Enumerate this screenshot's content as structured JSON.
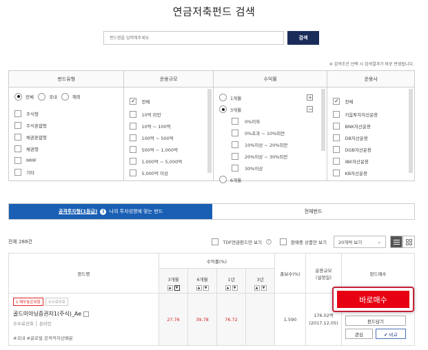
{
  "page": {
    "title": "연금저축펀드 검색"
  },
  "search": {
    "placeholder": "펀드명을 입력해주세요",
    "button": "검색"
  },
  "filter_note": "※ 검색조건 선택 시 검색결과가 바로 반영됩니다.",
  "filters": {
    "fund_type": {
      "title": "펀드유형",
      "radios": [
        "전체",
        "국내",
        "해외"
      ],
      "options": [
        "주식형",
        "주식혼합형",
        "채권혼합형",
        "채권형",
        "MMF",
        "기타"
      ]
    },
    "fund_size": {
      "title": "운용규모",
      "options": [
        "전체",
        "10억 미만",
        "10억 ~ 100억",
        "100억 ~ 500억",
        "500억 ~ 1,000억",
        "1,000억 ~ 5,000억",
        "5,000억 이상"
      ]
    },
    "returns": {
      "title": "수익률",
      "period_1m": "1개월",
      "period_3m": "3개월",
      "sub_options": [
        "0%이하",
        "0%초과 ~ 10%미만",
        "10%이상 ~ 20%미만",
        "20%이상 ~ 30%미만",
        "30%이상"
      ],
      "period_6m": "6개월",
      "plus": "+",
      "minus": "−"
    },
    "manager": {
      "title": "운용사",
      "options": [
        "전체",
        "키움투자자산운용",
        "BNK자산운용",
        "DB자산운용",
        "DGB자산운용",
        "IBK자산운용",
        "KB자산운용"
      ]
    }
  },
  "tabs": {
    "active_strong": "공격투자형(1등급)",
    "active_rest": "나의 투자성향에 맞는 펀드",
    "info_icon": "i",
    "inactive": "전체펀드"
  },
  "toolbar": {
    "total": "전체 288건",
    "tdf_label": "TDF연금펀드만 보기",
    "help": "?",
    "on_sale_label": "판매중 상품만 보기",
    "per_page": "20개씩 보기",
    "caret": "⌄"
  },
  "table": {
    "headers": {
      "fund_name": "펀드명",
      "returns": "수익률(%)",
      "periods": [
        "3개월",
        "6개월",
        "1년",
        "3년"
      ],
      "fee": "총보수(%)",
      "size_line1": "운용규모",
      "size_line2": "(설정일)",
      "buy": "펀드매수"
    },
    "sort": {
      "up": "▲",
      "down": "▼"
    },
    "rows": [
      {
        "badge_risk": "1 매우높은위험",
        "badge_fee": "수수료무료",
        "name": "골드미아닝증권자1(주식)_Ae",
        "meta": "수수료선취 │ 온라인",
        "tags": "#국내 #글로벌 공격적자산배분",
        "ret_3m": "27.76",
        "ret_6m": "39.78",
        "ret_1y": "76.72",
        "ret_3y": "",
        "fee": "1.590",
        "size": "176.02억",
        "date": "(2017.12.05)",
        "buy_label": "바로매수",
        "cart_label": "펀드담기",
        "interest_label": "관심",
        "compare_label": "✔ 비교"
      }
    ]
  }
}
